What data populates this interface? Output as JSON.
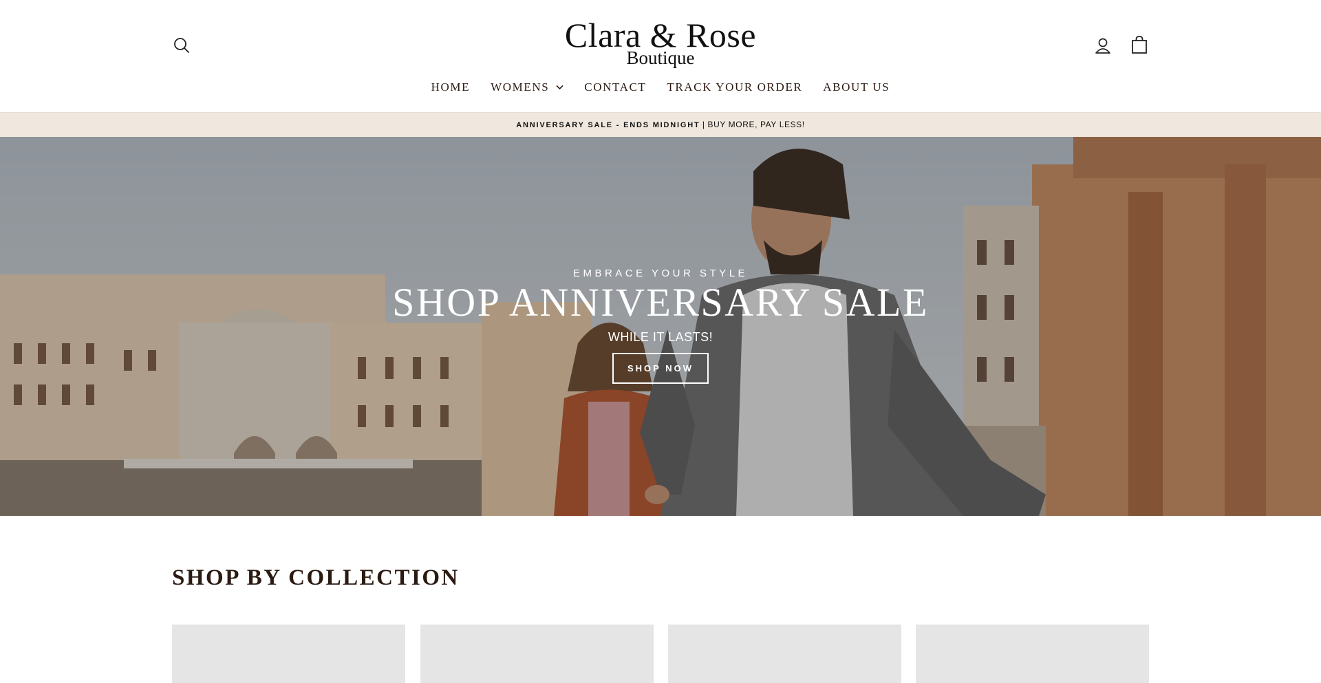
{
  "brand": {
    "logo_main": "Clara & Rose",
    "logo_sub": "Boutique"
  },
  "header_icons": {
    "search": "search-icon",
    "account": "user-icon",
    "cart": "bag-icon"
  },
  "nav": {
    "items": [
      {
        "label": "HOME"
      },
      {
        "label": "WOMENS",
        "has_dropdown": true
      },
      {
        "label": "CONTACT"
      },
      {
        "label": "TRACK YOUR ORDER"
      },
      {
        "label": "ABOUT US"
      }
    ]
  },
  "announcement": {
    "strong": "ANNIVERSARY SALE - ENDS MIDNIGHT",
    "rest": "| BUY MORE, PAY LESS!"
  },
  "hero": {
    "kicker": "EMBRACE YOUR STYLE",
    "title": "SHOP ANNIVERSARY SALE",
    "subtitle": "WHILE IT LASTS!",
    "button": "SHOP NOW"
  },
  "collections": {
    "title": "SHOP BY COLLECTION",
    "cards_count_visible": 4
  },
  "colors": {
    "text": "#2b1a12",
    "announce_bg": "#f0e8de",
    "card_placeholder": "#e5e5e5"
  }
}
